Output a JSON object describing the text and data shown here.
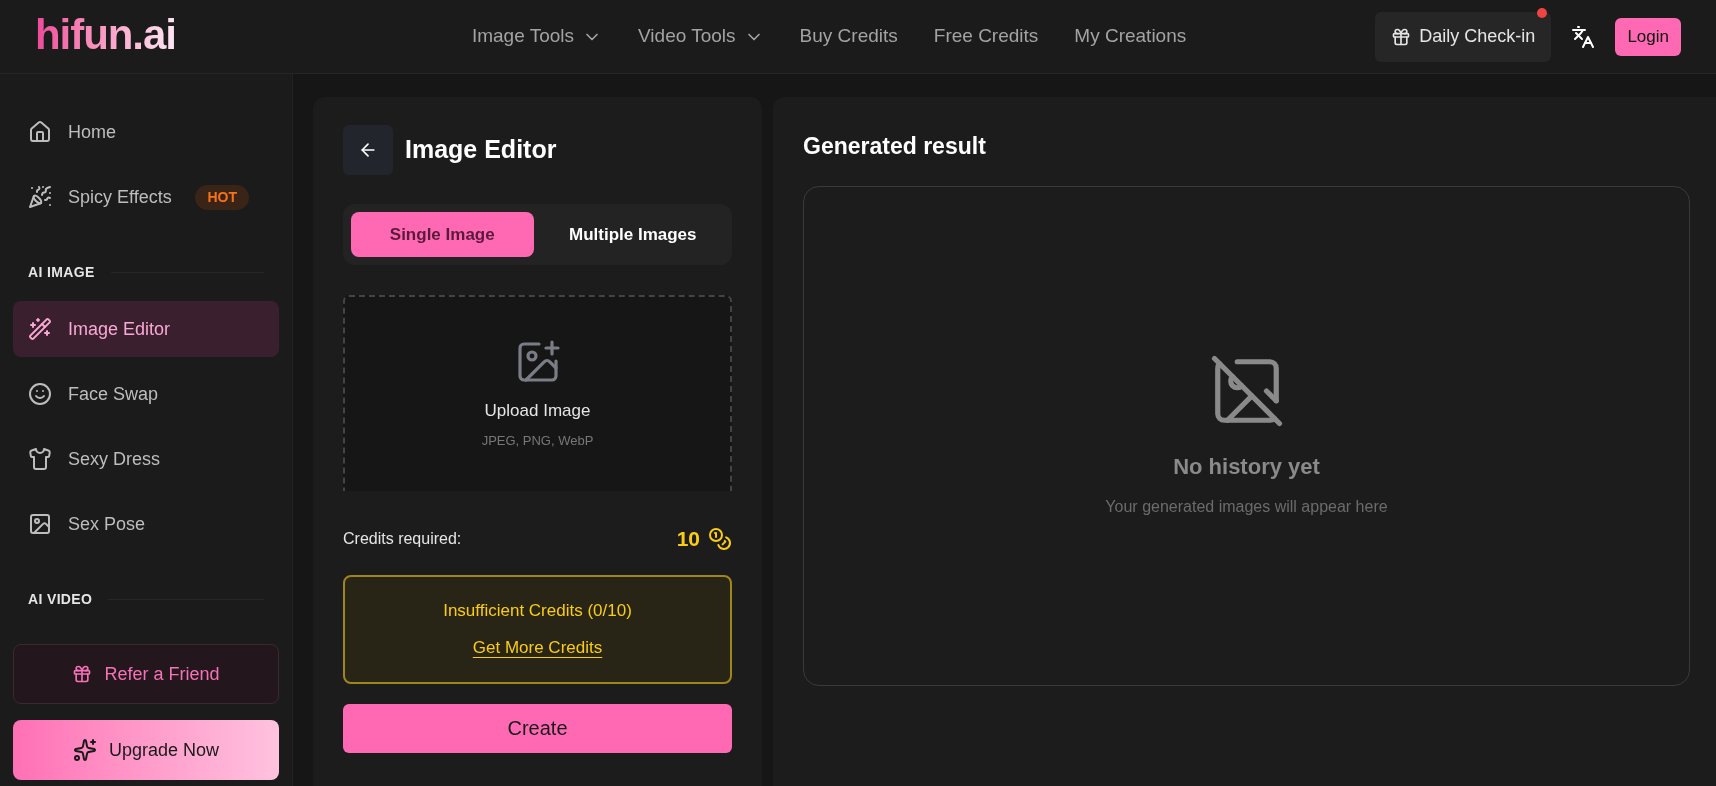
{
  "header": {
    "logo": "hifun.ai",
    "nav": [
      {
        "label": "Image Tools",
        "dropdown": true
      },
      {
        "label": "Video Tools",
        "dropdown": true
      },
      {
        "label": "Buy Credits",
        "dropdown": false
      },
      {
        "label": "Free Credits",
        "dropdown": false
      },
      {
        "label": "My Creations",
        "dropdown": false
      }
    ],
    "daily_checkin": {
      "label": "Daily Check-in",
      "notification": true
    },
    "login": "Login"
  },
  "sidebar": {
    "groups": [
      {
        "items": [
          {
            "label": "Home",
            "selected": false
          },
          {
            "label": "Spicy Effects",
            "selected": false,
            "badge": "HOT"
          }
        ]
      },
      {
        "title": "AI IMAGE",
        "items": [
          {
            "label": "Image Editor",
            "selected": true
          },
          {
            "label": "Face Swap",
            "selected": false
          },
          {
            "label": "Sexy Dress",
            "selected": false
          },
          {
            "label": "Sex Pose",
            "selected": false
          }
        ]
      },
      {
        "title": "AI VIDEO"
      }
    ],
    "refer": "Refer a Friend",
    "upgrade": "Upgrade Now"
  },
  "editor": {
    "title": "Image Editor",
    "tabs": [
      {
        "label": "Single Image",
        "selected": true
      },
      {
        "label": "Multiple Images",
        "selected": false
      }
    ],
    "upload": {
      "label": "Upload Image",
      "formats": "JPEG, PNG, WebP"
    },
    "credits_label": "Credits required:",
    "credits_value": "10",
    "warning": {
      "text": "Insufficient Credits (0/10)",
      "link": "Get More Credits"
    },
    "create": "Create"
  },
  "result": {
    "title": "Generated result",
    "empty_title": "No history yet",
    "empty_text": "Your generated images will appear here"
  }
}
